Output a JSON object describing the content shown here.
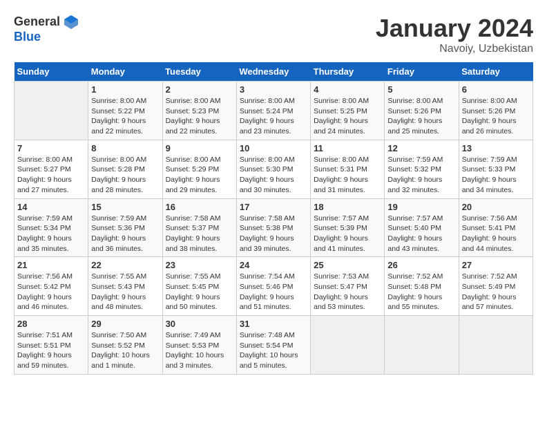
{
  "header": {
    "logo_general": "General",
    "logo_blue": "Blue",
    "main_title": "January 2024",
    "sub_title": "Navoiy, Uzbekistan"
  },
  "weekdays": [
    "Sunday",
    "Monday",
    "Tuesday",
    "Wednesday",
    "Thursday",
    "Friday",
    "Saturday"
  ],
  "weeks": [
    [
      {
        "day": "",
        "sunrise": "",
        "sunset": "",
        "daylight": ""
      },
      {
        "day": "1",
        "sunrise": "Sunrise: 8:00 AM",
        "sunset": "Sunset: 5:22 PM",
        "daylight": "Daylight: 9 hours and 22 minutes."
      },
      {
        "day": "2",
        "sunrise": "Sunrise: 8:00 AM",
        "sunset": "Sunset: 5:23 PM",
        "daylight": "Daylight: 9 hours and 22 minutes."
      },
      {
        "day": "3",
        "sunrise": "Sunrise: 8:00 AM",
        "sunset": "Sunset: 5:24 PM",
        "daylight": "Daylight: 9 hours and 23 minutes."
      },
      {
        "day": "4",
        "sunrise": "Sunrise: 8:00 AM",
        "sunset": "Sunset: 5:25 PM",
        "daylight": "Daylight: 9 hours and 24 minutes."
      },
      {
        "day": "5",
        "sunrise": "Sunrise: 8:00 AM",
        "sunset": "Sunset: 5:26 PM",
        "daylight": "Daylight: 9 hours and 25 minutes."
      },
      {
        "day": "6",
        "sunrise": "Sunrise: 8:00 AM",
        "sunset": "Sunset: 5:26 PM",
        "daylight": "Daylight: 9 hours and 26 minutes."
      }
    ],
    [
      {
        "day": "7",
        "sunrise": "Sunrise: 8:00 AM",
        "sunset": "Sunset: 5:27 PM",
        "daylight": "Daylight: 9 hours and 27 minutes."
      },
      {
        "day": "8",
        "sunrise": "Sunrise: 8:00 AM",
        "sunset": "Sunset: 5:28 PM",
        "daylight": "Daylight: 9 hours and 28 minutes."
      },
      {
        "day": "9",
        "sunrise": "Sunrise: 8:00 AM",
        "sunset": "Sunset: 5:29 PM",
        "daylight": "Daylight: 9 hours and 29 minutes."
      },
      {
        "day": "10",
        "sunrise": "Sunrise: 8:00 AM",
        "sunset": "Sunset: 5:30 PM",
        "daylight": "Daylight: 9 hours and 30 minutes."
      },
      {
        "day": "11",
        "sunrise": "Sunrise: 8:00 AM",
        "sunset": "Sunset: 5:31 PM",
        "daylight": "Daylight: 9 hours and 31 minutes."
      },
      {
        "day": "12",
        "sunrise": "Sunrise: 7:59 AM",
        "sunset": "Sunset: 5:32 PM",
        "daylight": "Daylight: 9 hours and 32 minutes."
      },
      {
        "day": "13",
        "sunrise": "Sunrise: 7:59 AM",
        "sunset": "Sunset: 5:33 PM",
        "daylight": "Daylight: 9 hours and 34 minutes."
      }
    ],
    [
      {
        "day": "14",
        "sunrise": "Sunrise: 7:59 AM",
        "sunset": "Sunset: 5:34 PM",
        "daylight": "Daylight: 9 hours and 35 minutes."
      },
      {
        "day": "15",
        "sunrise": "Sunrise: 7:59 AM",
        "sunset": "Sunset: 5:36 PM",
        "daylight": "Daylight: 9 hours and 36 minutes."
      },
      {
        "day": "16",
        "sunrise": "Sunrise: 7:58 AM",
        "sunset": "Sunset: 5:37 PM",
        "daylight": "Daylight: 9 hours and 38 minutes."
      },
      {
        "day": "17",
        "sunrise": "Sunrise: 7:58 AM",
        "sunset": "Sunset: 5:38 PM",
        "daylight": "Daylight: 9 hours and 39 minutes."
      },
      {
        "day": "18",
        "sunrise": "Sunrise: 7:57 AM",
        "sunset": "Sunset: 5:39 PM",
        "daylight": "Daylight: 9 hours and 41 minutes."
      },
      {
        "day": "19",
        "sunrise": "Sunrise: 7:57 AM",
        "sunset": "Sunset: 5:40 PM",
        "daylight": "Daylight: 9 hours and 43 minutes."
      },
      {
        "day": "20",
        "sunrise": "Sunrise: 7:56 AM",
        "sunset": "Sunset: 5:41 PM",
        "daylight": "Daylight: 9 hours and 44 minutes."
      }
    ],
    [
      {
        "day": "21",
        "sunrise": "Sunrise: 7:56 AM",
        "sunset": "Sunset: 5:42 PM",
        "daylight": "Daylight: 9 hours and 46 minutes."
      },
      {
        "day": "22",
        "sunrise": "Sunrise: 7:55 AM",
        "sunset": "Sunset: 5:43 PM",
        "daylight": "Daylight: 9 hours and 48 minutes."
      },
      {
        "day": "23",
        "sunrise": "Sunrise: 7:55 AM",
        "sunset": "Sunset: 5:45 PM",
        "daylight": "Daylight: 9 hours and 50 minutes."
      },
      {
        "day": "24",
        "sunrise": "Sunrise: 7:54 AM",
        "sunset": "Sunset: 5:46 PM",
        "daylight": "Daylight: 9 hours and 51 minutes."
      },
      {
        "day": "25",
        "sunrise": "Sunrise: 7:53 AM",
        "sunset": "Sunset: 5:47 PM",
        "daylight": "Daylight: 9 hours and 53 minutes."
      },
      {
        "day": "26",
        "sunrise": "Sunrise: 7:52 AM",
        "sunset": "Sunset: 5:48 PM",
        "daylight": "Daylight: 9 hours and 55 minutes."
      },
      {
        "day": "27",
        "sunrise": "Sunrise: 7:52 AM",
        "sunset": "Sunset: 5:49 PM",
        "daylight": "Daylight: 9 hours and 57 minutes."
      }
    ],
    [
      {
        "day": "28",
        "sunrise": "Sunrise: 7:51 AM",
        "sunset": "Sunset: 5:51 PM",
        "daylight": "Daylight: 9 hours and 59 minutes."
      },
      {
        "day": "29",
        "sunrise": "Sunrise: 7:50 AM",
        "sunset": "Sunset: 5:52 PM",
        "daylight": "Daylight: 10 hours and 1 minute."
      },
      {
        "day": "30",
        "sunrise": "Sunrise: 7:49 AM",
        "sunset": "Sunset: 5:53 PM",
        "daylight": "Daylight: 10 hours and 3 minutes."
      },
      {
        "day": "31",
        "sunrise": "Sunrise: 7:48 AM",
        "sunset": "Sunset: 5:54 PM",
        "daylight": "Daylight: 10 hours and 5 minutes."
      },
      {
        "day": "",
        "sunrise": "",
        "sunset": "",
        "daylight": ""
      },
      {
        "day": "",
        "sunrise": "",
        "sunset": "",
        "daylight": ""
      },
      {
        "day": "",
        "sunrise": "",
        "sunset": "",
        "daylight": ""
      }
    ]
  ]
}
